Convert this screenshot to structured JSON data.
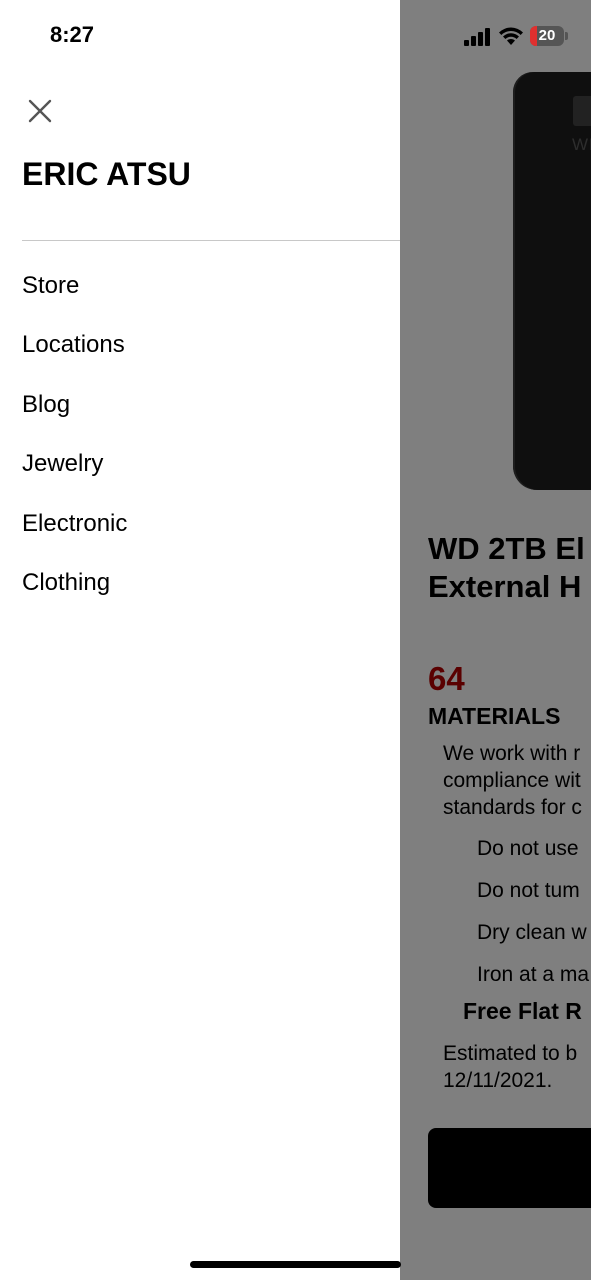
{
  "status_bar": {
    "time": "8:27",
    "battery_level": "20",
    "battery_fraction": 0.2
  },
  "drawer": {
    "title": "ERIC ATSU",
    "menu_items": [
      {
        "label": "Store"
      },
      {
        "label": "Locations"
      },
      {
        "label": "Blog"
      },
      {
        "label": "Jewelry"
      },
      {
        "label": "Electronic"
      },
      {
        "label": "Clothing"
      }
    ]
  },
  "product": {
    "device_brand_mark": "WD",
    "title_line1": "WD 2TB El",
    "title_line2": "External H",
    "price": "64",
    "section_heading": "MATERIALS",
    "description_lines": [
      "We work with r",
      "compliance wit",
      "standards for c"
    ],
    "care_items": [
      "Do not use",
      "Do not tum",
      "Dry clean w",
      "Iron at a ma"
    ],
    "shipping_title": "Free Flat R",
    "delivery_lines": [
      "Estimated to b",
      "12/11/2021."
    ]
  },
  "colors": {
    "price": "#b40000",
    "overlay": "rgba(0,0,0,0.5)",
    "battery_low": "#e0302f"
  }
}
